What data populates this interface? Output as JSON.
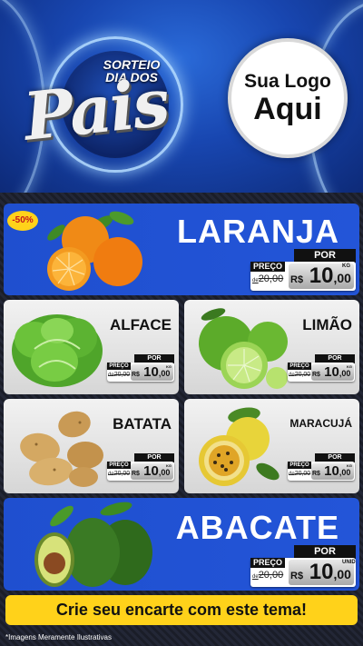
{
  "header": {
    "title_top": "SORTEIO\nDIA DOS",
    "title_main": "Pais",
    "logo_line1": "Sua Logo",
    "logo_line2": "Aqui"
  },
  "colors": {
    "card_blue": "#2355d8",
    "cta_yellow": "#ffd21a",
    "badge_red": "#c4161c"
  },
  "discount_badge": "-50%",
  "products": {
    "laranja": {
      "name": "LARANJA",
      "por": "POR",
      "preco": "PREÇO",
      "de": "de",
      "old": "20,00",
      "rs": "R$",
      "int": "10",
      "cents": ",00",
      "unit": "KG"
    },
    "alface": {
      "name": "ALFACE",
      "por": "POR",
      "preco": "PREÇO",
      "de": "de",
      "old": "20,00",
      "rs": "R$",
      "int": "10",
      "cents": ",00",
      "unit": "KG"
    },
    "limao": {
      "name": "LIMÃO",
      "por": "POR",
      "preco": "PREÇO",
      "de": "de",
      "old": "20,00",
      "rs": "R$",
      "int": "10",
      "cents": ",00",
      "unit": "KG"
    },
    "batata": {
      "name": "BATATA",
      "por": "POR",
      "preco": "PREÇO",
      "de": "de",
      "old": "20,00",
      "rs": "R$",
      "int": "10",
      "cents": ",00",
      "unit": "KG"
    },
    "maracuja": {
      "name": "MARACUJÁ",
      "por": "POR",
      "preco": "PREÇO",
      "de": "de",
      "old": "20,00",
      "rs": "R$",
      "int": "10",
      "cents": ",00",
      "unit": "KG"
    },
    "abacate": {
      "name": "ABACATE",
      "por": "POR",
      "preco": "PREÇO",
      "de": "de",
      "old": "20,00",
      "rs": "R$",
      "int": "10",
      "cents": ",00",
      "unit": "UNID"
    }
  },
  "cta": "Crie seu encarte com este tema!",
  "footnote": "*Imagens Meramente Ilustrativas"
}
